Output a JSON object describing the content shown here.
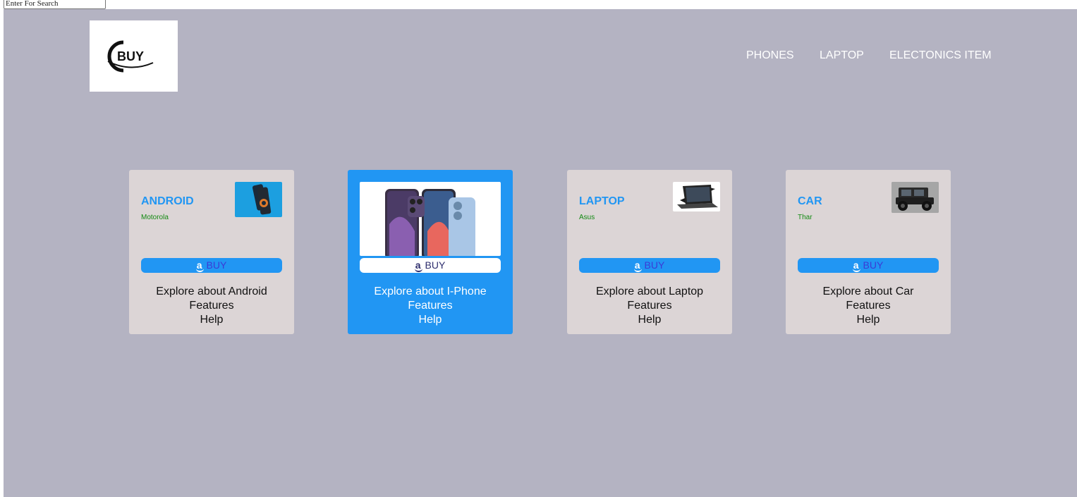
{
  "search": {
    "placeholder": "Enter For Search"
  },
  "nav": {
    "phones": "PHONES",
    "laptop": "LAPTOP",
    "electronics": "ELECTONICS ITEM"
  },
  "colors": {
    "background": "#b4b3c2",
    "card": "#dcd5d6",
    "accent": "#2196f3",
    "subtitle": "#138a13"
  },
  "cards": [
    {
      "title": "ANDROID",
      "subtitle": "Motorola",
      "buy": "BUY",
      "explore": "Explore about Android",
      "features": "Features",
      "help": "Help",
      "icon": "android-phone-image"
    },
    {
      "title": "",
      "subtitle": "",
      "buy": "BUY",
      "explore": "Explore about I-Phone",
      "features": "Features",
      "help": "Help",
      "icon": "iphone-image"
    },
    {
      "title": "LAPTOP",
      "subtitle": "Asus",
      "buy": "BUY",
      "explore": "Explore about Laptop",
      "features": "Features",
      "help": "Help",
      "icon": "laptop-image"
    },
    {
      "title": "CAR",
      "subtitle": "Thar",
      "buy": "BUY",
      "explore": "Explore about Car",
      "features": "Features",
      "help": "Help",
      "icon": "car-image"
    }
  ],
  "brand": {
    "logo_text": "BUY"
  }
}
